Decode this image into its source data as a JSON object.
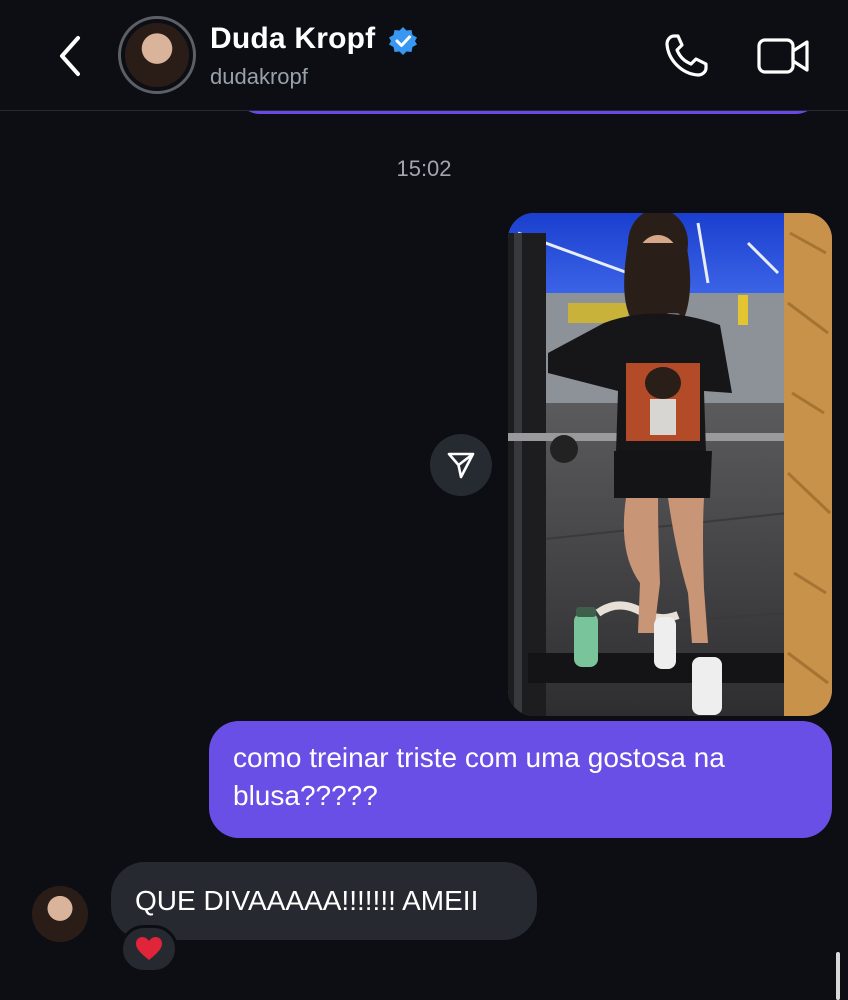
{
  "header": {
    "name": "Duda Kropf",
    "handle": "dudakropf"
  },
  "thread": {
    "timestamp": "15:02",
    "outgoing_message": "como treinar triste com uma gostosa na blusa?????",
    "incoming_message": "QUE DIVAAAAA!!!!!!! AMEII",
    "reaction": "❤️"
  },
  "colors": {
    "background": "#0c0e13",
    "outgoing_bubble": "#6a4fe6",
    "incoming_bubble": "#262a30",
    "verified_badge": "#3897f0"
  },
  "icons": {
    "back": "chevron-left-icon",
    "verified": "verified-badge-icon",
    "call": "phone-icon",
    "video": "video-camera-icon",
    "share": "send-icon",
    "reaction": "heart-icon"
  }
}
